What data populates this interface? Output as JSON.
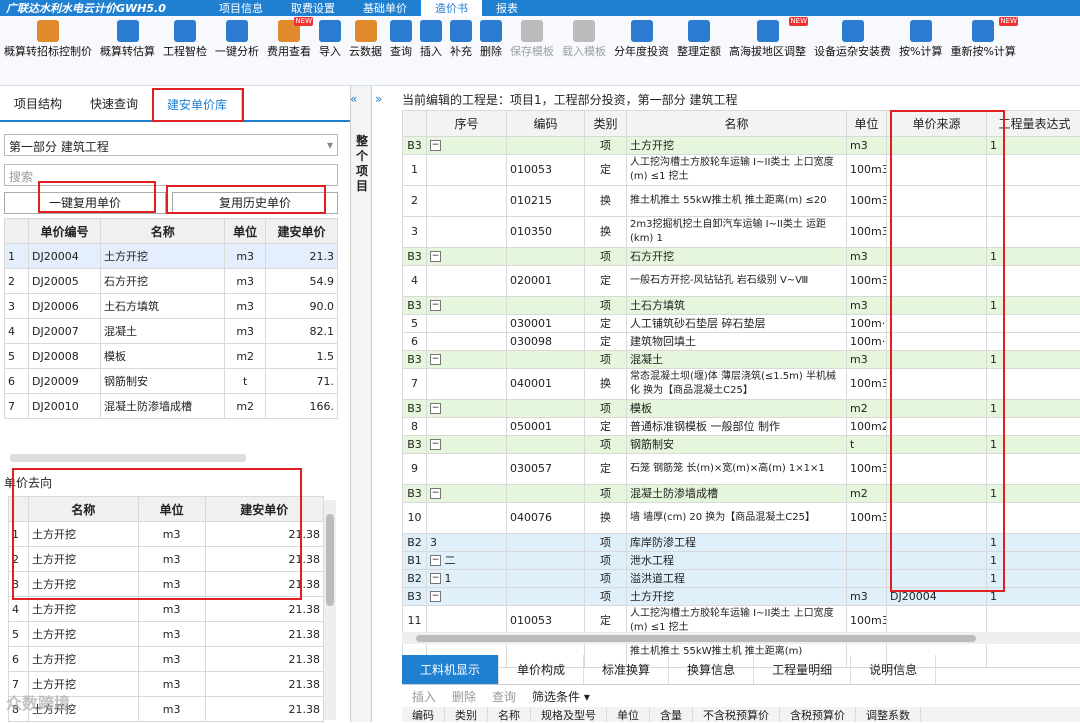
{
  "app": {
    "title": "广联达水利水电云计价GWH5.0"
  },
  "menu": [
    "项目信息",
    "取费设置",
    "基础单价",
    "造价书",
    "报表"
  ],
  "toolbar": [
    {
      "label": "概算转招标控制价",
      "c": "#e08a2c"
    },
    {
      "label": "概算转估算",
      "c": "#2b7bd1"
    },
    {
      "label": "工程智检",
      "c": "#2b7bd1"
    },
    {
      "label": "一键分析",
      "c": "#2b7bd1"
    },
    {
      "label": "费用查看",
      "c": "#e08a2c",
      "new": true
    },
    {
      "label": "导入",
      "c": "#2b7bd1"
    },
    {
      "label": "云数据",
      "c": "#e08a2c"
    },
    {
      "label": "查询",
      "c": "#2b7bd1"
    },
    {
      "label": "插入",
      "c": "#2b7bd1"
    },
    {
      "label": "补充",
      "c": "#2b7bd1"
    },
    {
      "label": "删除",
      "c": "#2b7bd1"
    },
    {
      "label": "保存模板",
      "c": "#bbb",
      "dis": true
    },
    {
      "label": "载入模板",
      "c": "#bbb",
      "dis": true
    },
    {
      "label": "分年度投资",
      "c": "#2b7bd1"
    },
    {
      "label": "整理定额",
      "c": "#2b7bd1"
    },
    {
      "label": "高海拔地区调整",
      "c": "#2b7bd1",
      "new": true
    },
    {
      "label": "设备运杂安装费",
      "c": "#2b7bd1"
    },
    {
      "label": "按%计算",
      "c": "#2b7bd1"
    },
    {
      "label": "重新按%计算",
      "c": "#2b7bd1",
      "new": true
    }
  ],
  "left": {
    "tabs": [
      "项目结构",
      "快速查询",
      "建安单价库"
    ],
    "select": "第一部分  建筑工程",
    "search": "搜索",
    "btn1": "一键复用单价",
    "btn2": "复用历史单价",
    "cols": [
      "单价编号",
      "名称",
      "单位",
      "建安单价"
    ],
    "rows": [
      [
        "1",
        "DJ20004",
        "土方开挖",
        "m3",
        "21.3"
      ],
      [
        "2",
        "DJ20005",
        "石方开挖",
        "m3",
        "54.9"
      ],
      [
        "3",
        "DJ20006",
        "土石方填筑",
        "m3",
        "90.0"
      ],
      [
        "4",
        "DJ20007",
        "混凝土",
        "m3",
        "82.1"
      ],
      [
        "5",
        "DJ20008",
        "模板",
        "m2",
        "1.5"
      ],
      [
        "6",
        "DJ20009",
        "钢筋制安",
        "t",
        "71."
      ],
      [
        "7",
        "DJ20010",
        "混凝土防渗墙成槽",
        "m2",
        "166."
      ]
    ],
    "lower_title": "单价去向",
    "cols2": [
      "名称",
      "单位",
      "建安单价"
    ],
    "rows2": [
      [
        "1",
        "土方开挖",
        "m3",
        "21.38"
      ],
      [
        "2",
        "土方开挖",
        "m3",
        "21.38"
      ],
      [
        "3",
        "土方开挖",
        "m3",
        "21.38"
      ],
      [
        "4",
        "土方开挖",
        "m3",
        "21.38"
      ],
      [
        "5",
        "土方开挖",
        "m3",
        "21.38"
      ],
      [
        "6",
        "土方开挖",
        "m3",
        "21.38"
      ],
      [
        "7",
        "土方开挖",
        "m3",
        "21.38"
      ],
      [
        "8",
        "土方开挖",
        "m3",
        "21.38"
      ]
    ]
  },
  "side_label": "整个项目",
  "main": {
    "crumb": "当前编辑的工程是：项目1，工程部分投资，第一部分 建筑工程",
    "cols": [
      "",
      "序号",
      "编码",
      "类别",
      "名称",
      "单位",
      "单价来源",
      "工程量表达式"
    ],
    "rows": [
      {
        "t": "g",
        "c": [
          "B3",
          "⊟",
          "",
          "项",
          "土方开挖",
          "m3",
          "",
          "1"
        ]
      },
      {
        "t": "",
        "c": [
          "1",
          "",
          "010053",
          "定",
          "人工挖沟槽土方胶轮车运输 I~II类土 上口宽度(m) ≤1 挖土",
          "100m3",
          "",
          ""
        ]
      },
      {
        "t": "",
        "c": [
          "2",
          "",
          "010215",
          "换",
          "推土机推土 55kW推土机 推土距离(m) ≤20",
          "100m3",
          "",
          ""
        ]
      },
      {
        "t": "",
        "c": [
          "3",
          "",
          "010350",
          "换",
          "2m3挖掘机挖土自卸汽车运输 I~II类土 运距(km) 1",
          "100m3",
          "",
          ""
        ]
      },
      {
        "t": "g",
        "c": [
          "B3",
          "⊟",
          "",
          "项",
          "石方开挖",
          "m3",
          "",
          "1"
        ]
      },
      {
        "t": "",
        "c": [
          "4",
          "",
          "020001",
          "定",
          "一般石方开挖-风钻钻孔 岩石级别 V~Ⅷ",
          "100m3",
          "",
          ""
        ]
      },
      {
        "t": "g",
        "c": [
          "B3",
          "⊟",
          "",
          "项",
          "土石方填筑",
          "m3",
          "",
          "1"
        ]
      },
      {
        "t": "",
        "c": [
          "5",
          "",
          "030001",
          "定",
          "人工铺筑砂石垫层 碎石垫层",
          "100m···",
          "",
          ""
        ]
      },
      {
        "t": "",
        "c": [
          "6",
          "",
          "030098",
          "定",
          "建筑物回填土",
          "100m···",
          "",
          ""
        ]
      },
      {
        "t": "g",
        "c": [
          "B3",
          "⊟",
          "",
          "项",
          "混凝土",
          "m3",
          "",
          "1"
        ]
      },
      {
        "t": "",
        "c": [
          "7",
          "",
          "040001",
          "换",
          "常态混凝土坝(堰)体 薄层浇筑(≤1.5m) 半机械化  换为【商品混凝土C25】",
          "100m3",
          "",
          ""
        ]
      },
      {
        "t": "g",
        "c": [
          "B3",
          "⊟",
          "",
          "项",
          "模板",
          "m2",
          "",
          "1"
        ]
      },
      {
        "t": "",
        "c": [
          "8",
          "",
          "050001",
          "定",
          "普通标准钢模板 一般部位 制作",
          "100m2",
          "",
          ""
        ]
      },
      {
        "t": "g",
        "c": [
          "B3",
          "⊟",
          "",
          "项",
          "钢筋制安",
          "t",
          "",
          "1"
        ]
      },
      {
        "t": "",
        "c": [
          "9",
          "",
          "030057",
          "定",
          "石笼 钢筋笼 长(m)×宽(m)×高(m) 1×1×1",
          "100m3",
          "",
          ""
        ]
      },
      {
        "t": "g",
        "c": [
          "B3",
          "⊟",
          "",
          "项",
          "混凝土防渗墙成槽",
          "m2",
          "",
          "1"
        ]
      },
      {
        "t": "",
        "c": [
          "10",
          "",
          "040076",
          "换",
          "墙 墙厚(cm) 20  换为【商品混凝土C25】",
          "100m3",
          "",
          ""
        ]
      },
      {
        "t": "b",
        "c": [
          "B2",
          "3",
          "",
          "项",
          "库岸防渗工程",
          "",
          "",
          "1"
        ]
      },
      {
        "t": "b",
        "c": [
          "B1",
          "⊟ 二",
          "",
          "项",
          "泄水工程",
          "",
          "",
          "1"
        ]
      },
      {
        "t": "b",
        "c": [
          "B2",
          "⊟ 1",
          "",
          "项",
          "溢洪道工程",
          "",
          "",
          "1"
        ]
      },
      {
        "t": "b",
        "c": [
          "B3",
          "⊟",
          "",
          "项",
          "土方开挖",
          "m3",
          "DJ20004",
          "1"
        ]
      },
      {
        "t": "",
        "c": [
          "11",
          "",
          "010053",
          "定",
          "人工挖沟槽土方胶轮车运输 I~II类土 上口宽度(m) ≤1 挖土",
          "100m3",
          "",
          ""
        ]
      },
      {
        "t": "",
        "c": [
          "",
          "",
          "",
          "",
          "推土机推土 55kW推土机 推土距离(m)",
          "",
          "",
          ""
        ]
      }
    ]
  },
  "bottom": {
    "tabs": [
      "工料机显示",
      "单价构成",
      "标准换算",
      "换算信息",
      "工程量明细",
      "说明信息"
    ],
    "actions": [
      "插入",
      "删除",
      "查询"
    ],
    "filter": "筛选条件",
    "cols": [
      "编码",
      "类别",
      "名称",
      "规格及型号",
      "单位",
      "含量",
      "不含税预算价",
      "含税预算价",
      "调整系数"
    ]
  },
  "watermark": "众数跨境"
}
